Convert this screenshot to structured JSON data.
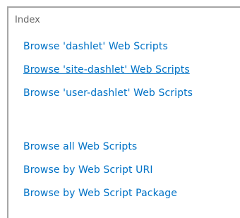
{
  "index": {
    "title": "Index",
    "group1": [
      {
        "label": "Browse 'dashlet' Web Scripts"
      },
      {
        "label": "Browse 'site-dashlet' Web Scripts"
      },
      {
        "label": "Browse 'user-dashlet' Web Scripts"
      }
    ],
    "group2": [
      {
        "label": "Browse all Web Scripts"
      },
      {
        "label": "Browse by Web Script URI"
      },
      {
        "label": "Browse by Web Script Package"
      }
    ],
    "colors": {
      "link": "#0072c6",
      "title": "#666666",
      "border": "#a6a6a6"
    }
  }
}
